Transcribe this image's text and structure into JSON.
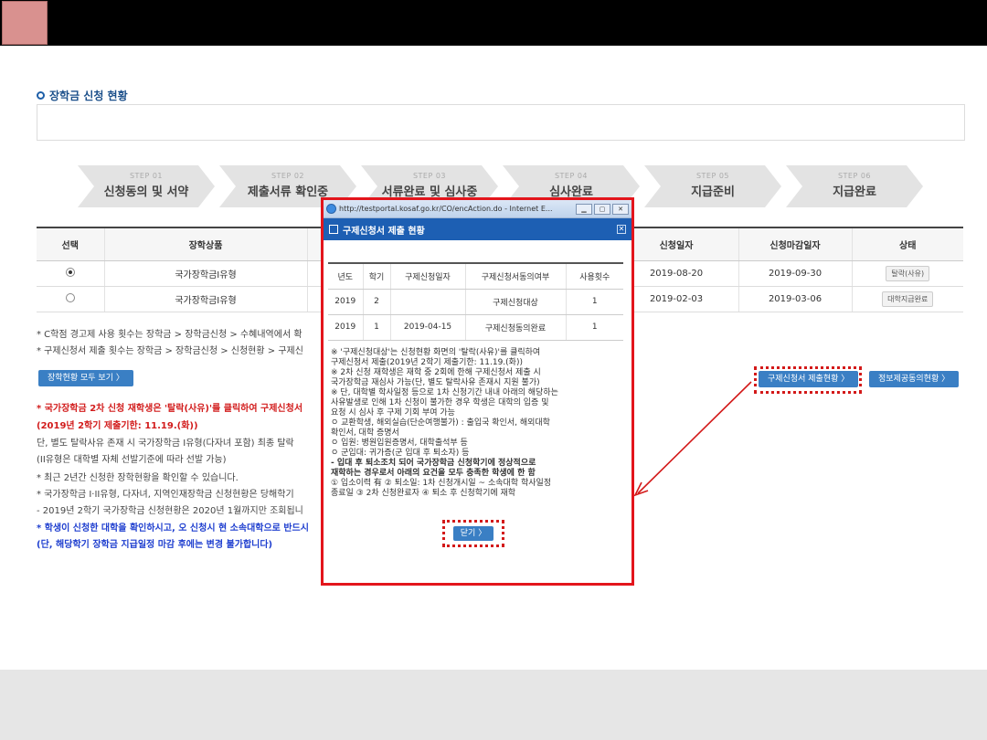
{
  "section_title": "장학금 신청 현황",
  "steps": [
    {
      "num": "STEP 01",
      "label": "신청동의 및 서약"
    },
    {
      "num": "STEP 02",
      "label": "제출서류 확인중"
    },
    {
      "num": "STEP 03",
      "label": "서류완료 및 심사중"
    },
    {
      "num": "STEP 04",
      "label": "심사완료"
    },
    {
      "num": "STEP 05",
      "label": "지급준비"
    },
    {
      "num": "STEP 06",
      "label": "지급완료"
    }
  ],
  "table": {
    "headers": [
      "선택",
      "장학상품",
      "",
      "신청일자",
      "신청마감일자",
      "상태"
    ],
    "rows": [
      {
        "product": "국가장학금I유형",
        "apply_date": "2019-08-20",
        "deadline": "2019-09-30",
        "status": "탈락(사유)"
      },
      {
        "product": "국가장학금I유형",
        "apply_date": "2019-02-03",
        "deadline": "2019-03-06",
        "status": "대학지급완료"
      }
    ]
  },
  "notes": [
    "* C학점 경고제 사용 횟수는 장학금 > 장학금신청 > 수혜내역에서 확",
    "* 구제신청서 제출 횟수는 장학금 > 장학금신청 > 신청현황 > 구제신"
  ],
  "buttons": {
    "view_all": "장학현황 모두 보기 〉",
    "relief_status": "구제신청서 제출현황 〉",
    "info_share": "정보제공동의현황 〉"
  },
  "lower_list": [
    {
      "text": "* 국가장학금 2차 신청 재학생은 '탈락(사유)'를 클릭하여 구제신청서",
      "style": "red"
    },
    {
      "text": "  (2019년 2학기 제출기한: 11.19.(화))",
      "style": "red"
    },
    {
      "text": "  단, 별도 탈락사유 존재 시 국가장학금 I유형(다자녀 포함) 최종 탈락",
      "style": "dk"
    },
    {
      "text": "  (II유형은 대학별 자체 선발기준에 따라 선발 가능)",
      "style": "dk"
    },
    {
      "text": "* 최근 2년간 신청한 장학현황을 확인할 수 있습니다.",
      "style": "dk"
    },
    {
      "text": "* 국가장학금 I·II유형, 다자녀, 지역인재장학금 신청현황은 당해학기",
      "style": "dk"
    },
    {
      "text": "  - 2019년 2학기 국가장학금 신청현황은 2020년 1월까지만 조회됩니",
      "style": "dk"
    },
    {
      "text": "* 학생이 신청한 대학을 확인하시고, 오 신청시 현 소속대학으로 반드시",
      "style": "blu"
    },
    {
      "text": "  (단, 해당학기 장학금 지급일정 마감 후에는 변경 불가합니다)",
      "style": "blu"
    }
  ],
  "popup": {
    "window_title": "http://testportal.kosaf.go.kr/CO/encAction.do - Internet E...",
    "header": "구제신청서 제출 현황",
    "table_headers": [
      "년도",
      "학기",
      "구제신청일자",
      "구제신청서동의여부",
      "사용횟수"
    ],
    "rows": [
      {
        "year": "2019",
        "term": "2",
        "date": "",
        "consent": "구제신청대상",
        "count": "1"
      },
      {
        "year": "2019",
        "term": "1",
        "date": "2019-04-15",
        "consent": "구제신청동의완료",
        "count": "1"
      }
    ],
    "notes": [
      "※ '구제신청대상'는 신청현황 화면의 '탈락(사유)'를 클릭하여",
      "   구제신청서 제출(2019년 2학기 제출기한: 11.19.(화))",
      "※ 2차 신청 재학생은 재학 중 2회에 한해 구제신청서 제출 시",
      "   국가장학금 재심사 가능(단, 별도 탈락사유 존재시 지원 불가)",
      "※ 단, 대학별 학사일정 등으로 1차 신청기간 내내 아래의 해당하는",
      "   사유발생로 인해 1차 신청이 불가한 경우 학생은 대학의 입증 및",
      "   요청 시 심사 후 구제 기회 부여 가능",
      " ㅇ 교환학생, 해외실습(단순여행불가) : 출입국 확인서, 해외대학",
      "    확인서, 대학 증명서",
      " ㅇ 입원: 병원입원증명서, 대학출석부 등",
      " ㅇ 군입대: 귀가증(군 입대 후 퇴소자) 등",
      "  - 입대 후 퇴소조치 되어 국가장학금 신청학기에 정상적으로",
      "    재학하는 경우로서 아래의 요건을 모두 충족한 학생에 한 함",
      "    ① 입소이력 有 ② 퇴소일: 1차 신청개시일 ~ 소속대학 학사일정",
      "    종료일 ③ 2차 신청완료자 ④ 퇴소 후 신청학기에 재학"
    ],
    "close_label": "닫기 〉"
  },
  "colors": {
    "accent_red": "#d31919",
    "brand_blue": "#1d5fb3"
  }
}
